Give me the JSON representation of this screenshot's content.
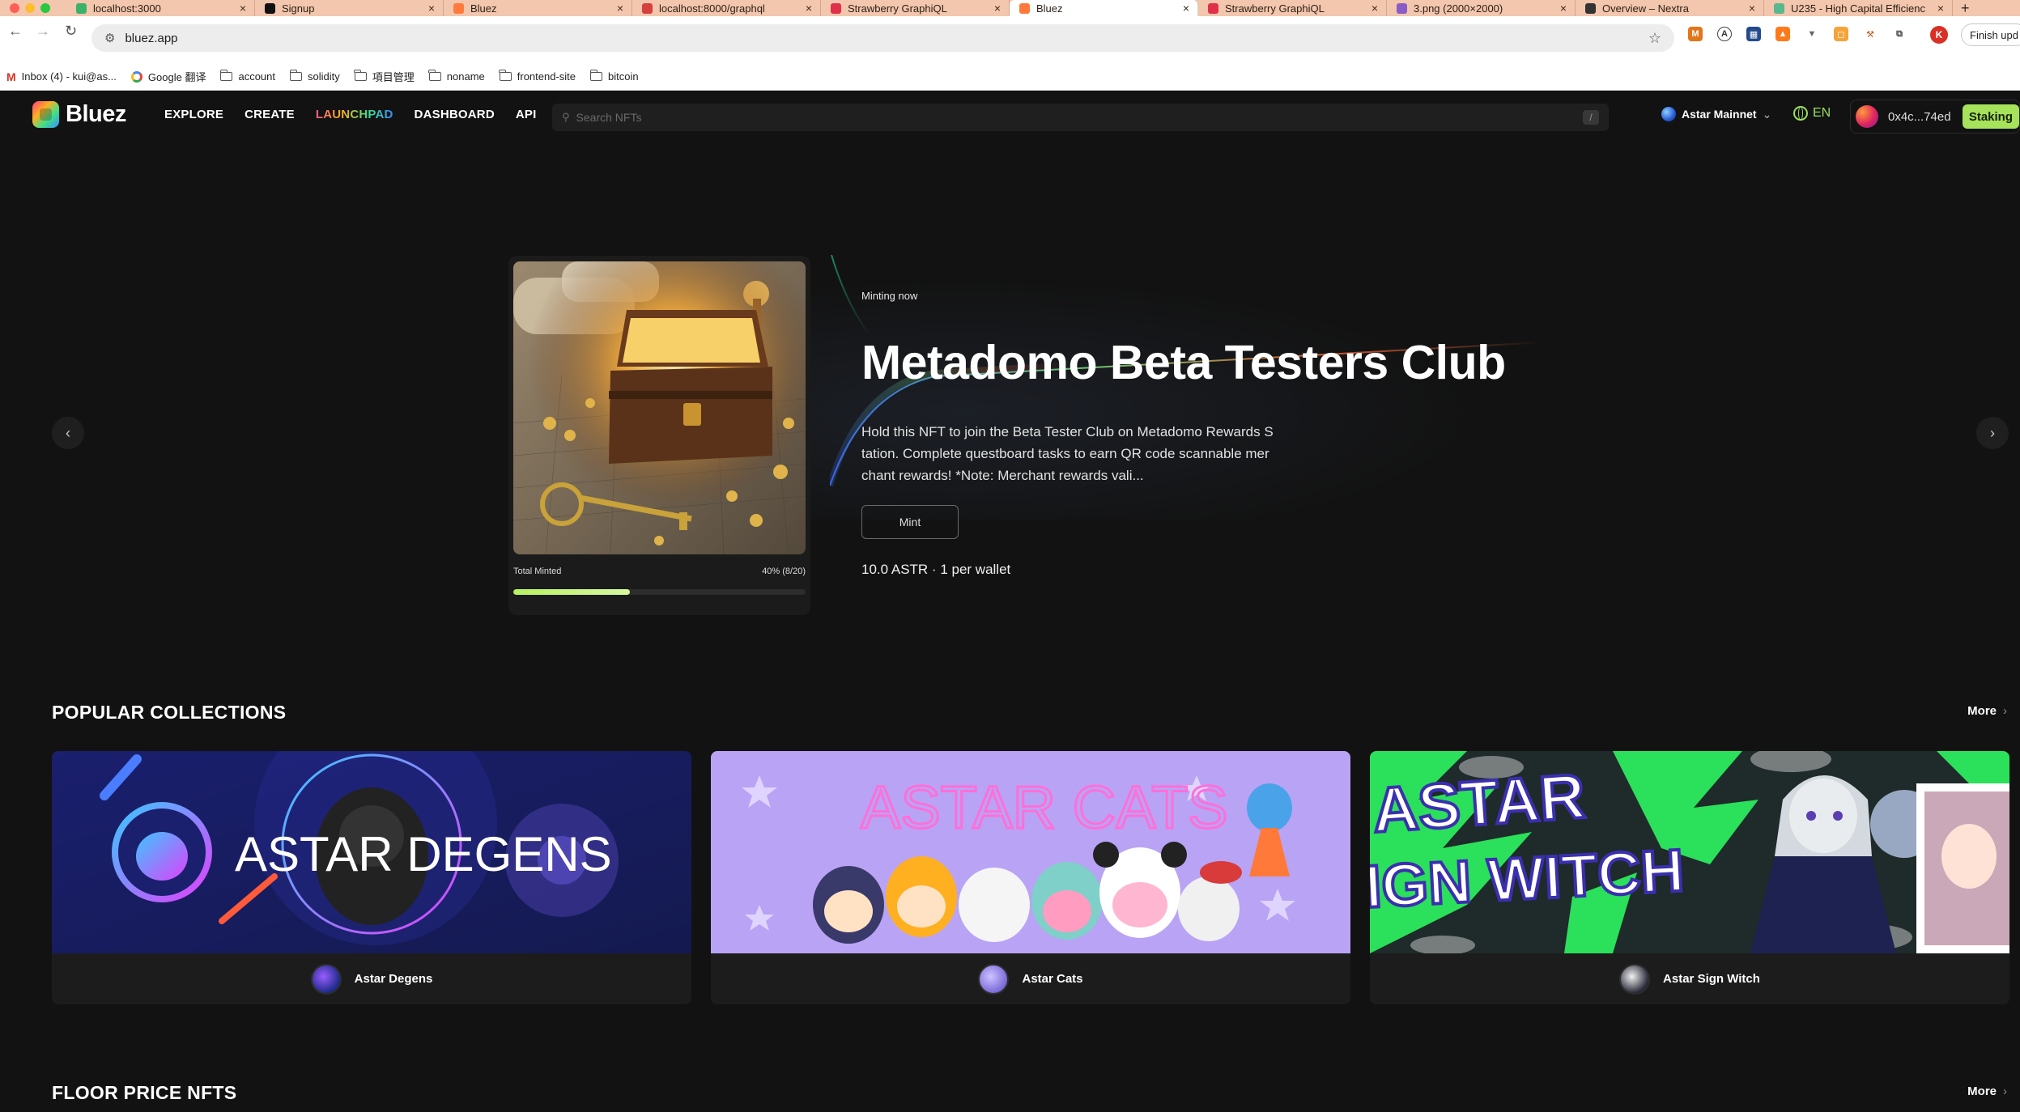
{
  "browser": {
    "tabs": [
      {
        "title": "localhost:3000",
        "active": false,
        "color": "#3ab26a"
      },
      {
        "title": "Signup",
        "active": false,
        "color": "#111111"
      },
      {
        "title": "Bluez",
        "active": false,
        "color": "#ff7a3c"
      },
      {
        "title": "localhost:8000/graphql",
        "active": false,
        "color": "#d6403c"
      },
      {
        "title": "Strawberry GraphiQL",
        "active": false,
        "color": "#e0314a"
      },
      {
        "title": "Bluez",
        "active": true,
        "color": "#ff7a3c"
      },
      {
        "title": "Strawberry GraphiQL",
        "active": false,
        "color": "#e0314a"
      },
      {
        "title": "3.png (2000×2000)",
        "active": false,
        "color": "#8a5cc7"
      },
      {
        "title": "Overview – Nextra",
        "active": false,
        "color": "#333333"
      },
      {
        "title": "U235 - High Capital Efficienc",
        "active": false,
        "color": "#5ab88f"
      }
    ],
    "url": "bluez.app",
    "finish_update": "Finish upd",
    "profile_initial": "K",
    "bookmarks": [
      {
        "label": "Inbox (4) - kui@as...",
        "icon": "gmail-icon"
      },
      {
        "label": "Google 翻译",
        "icon": "google-icon"
      },
      {
        "label": "account",
        "icon": "folder-icon"
      },
      {
        "label": "solidity",
        "icon": "folder-icon"
      },
      {
        "label": "項目管理",
        "icon": "folder-icon"
      },
      {
        "label": "noname",
        "icon": "folder-icon"
      },
      {
        "label": "frontend-site",
        "icon": "folder-icon"
      },
      {
        "label": "bitcoin",
        "icon": "folder-icon"
      }
    ]
  },
  "site": {
    "logo": "Bluez",
    "menu": [
      "EXPLORE",
      "CREATE",
      "LAUNCHPAD",
      "DASHBOARD",
      "API"
    ],
    "search_placeholder": "Search NFTs",
    "search_shortcut": "/",
    "network": "Astar Mainnet",
    "language": "EN",
    "wallet_address": "0x4c...74ed",
    "staking_label": "Staking"
  },
  "hero": {
    "eyebrow": "Minting now",
    "title": "Metadomo Beta Testers Club",
    "description": "Hold this NFT to join the Beta Tester Club on Metadomo Rewards Station. Complete questboard tasks to earn QR code scannable merchant rewards! *Note: Merchant rewards vali...",
    "mint_label": "Mint",
    "price": "10.0 ASTR · 1 per wallet",
    "total_minted_label": "Total Minted",
    "minted_pct_label": "40% (8/20)",
    "minted_fraction": 0.4,
    "prev_icon": "chevron-left-icon",
    "next_icon": "chevron-right-icon"
  },
  "popular": {
    "title": "POPULAR COLLECTIONS",
    "more": "More",
    "collections": [
      {
        "name": "Astar Degens",
        "banner_text": "ASTAR DEGENS"
      },
      {
        "name": "Astar Cats",
        "banner_text": "ASTAR CATS"
      },
      {
        "name": "Astar Sign Witch",
        "banner_text": "ASTAR\nIGN WITCH"
      }
    ]
  },
  "floor": {
    "title": "FLOOR PRICE NFTS",
    "more": "More"
  },
  "colors": {
    "accent_green": "#a6e25a",
    "background": "#121212",
    "tabstrip": "#f3c6ae"
  }
}
